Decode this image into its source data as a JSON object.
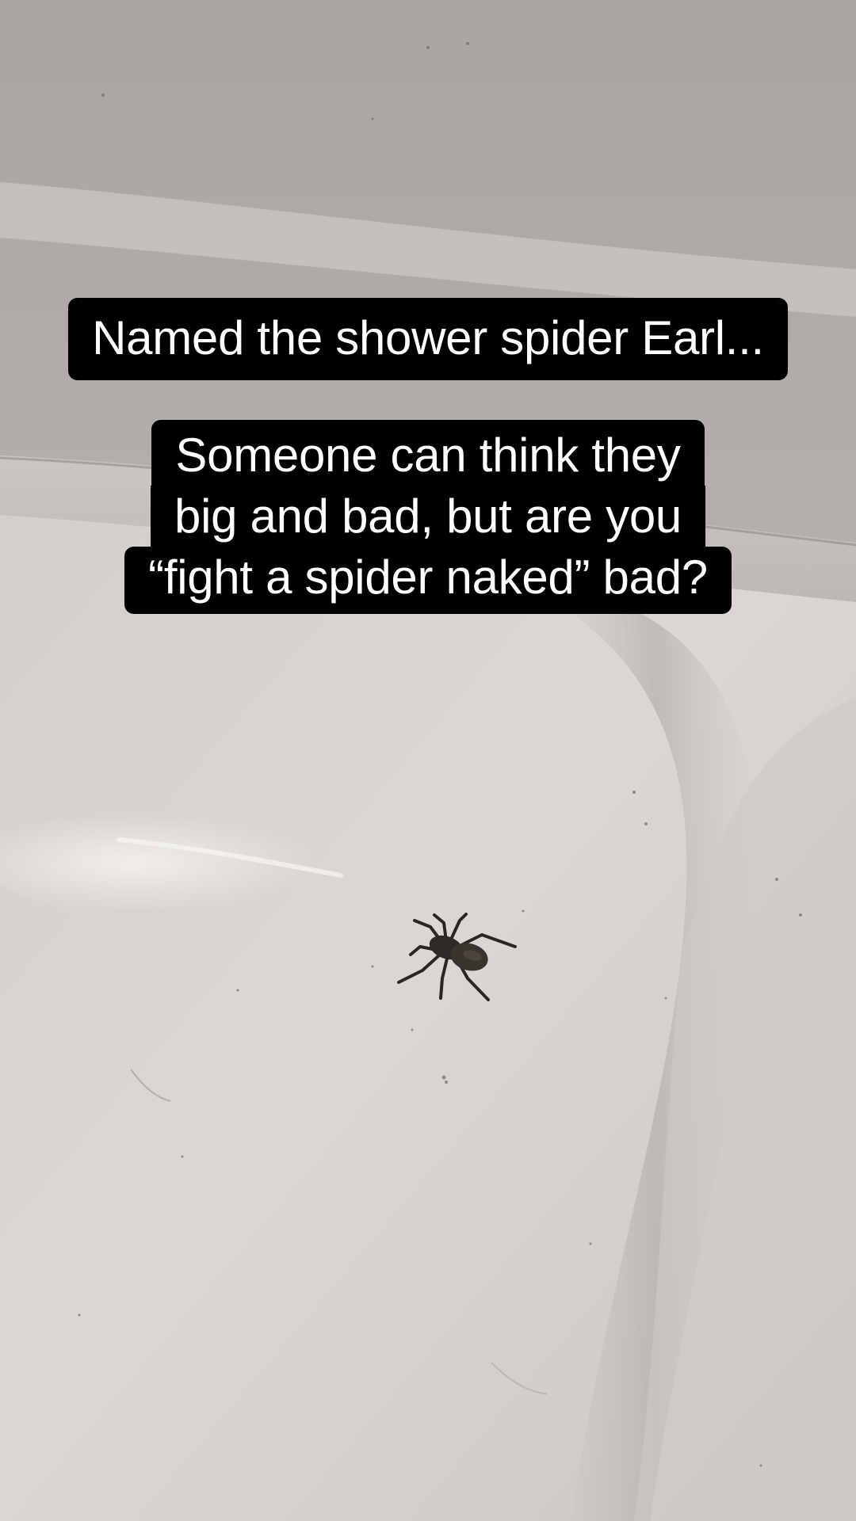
{
  "caption_top": "Named the shower spider Earl...",
  "caption_bottom": {
    "lines": [
      "Someone can think they",
      "big and bad, but are you",
      "“fight a spider naked” bad?"
    ]
  },
  "colors": {
    "caption_background": "#000000",
    "caption_text": "#ffffff",
    "tub_surface": "#d8d4d0",
    "wall": "#b9b5b2",
    "spider": "#2b2622"
  }
}
